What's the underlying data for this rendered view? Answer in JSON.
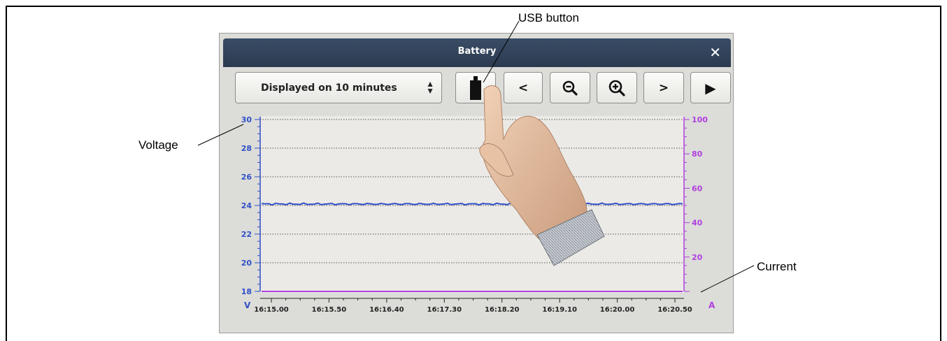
{
  "callouts": {
    "usb": "USB button",
    "voltage": "Voltage",
    "current": "Current"
  },
  "window": {
    "title": "Battery",
    "close_glyph": "✕"
  },
  "toolbar": {
    "range_select": {
      "value": "Displayed on 10 minutes",
      "icon": "up-down-arrows-icon"
    },
    "usb_button": {
      "icon": "usb-stick-icon"
    },
    "prev_button": {
      "glyph": "<",
      "icon": "chevron-left-icon"
    },
    "zoom_out_button": {
      "icon": "zoom-out-icon"
    },
    "zoom_in_button": {
      "icon": "zoom-in-icon"
    },
    "next_button": {
      "glyph": ">",
      "icon": "chevron-right-icon"
    },
    "play_button": {
      "glyph": "▶",
      "icon": "play-icon"
    }
  },
  "chart_data": {
    "type": "line",
    "x": [
      "16:15.00",
      "16:15.50",
      "16:16.40",
      "16:17.30",
      "16:18.20",
      "16:19.10",
      "16:20.00",
      "16:20.50"
    ],
    "y_left": {
      "unit": "V",
      "ylim": [
        18,
        30
      ],
      "ticks": [
        18,
        20,
        22,
        24,
        26,
        28,
        30
      ],
      "color": "#3050c8"
    },
    "y_right": {
      "unit": "A",
      "ylim": [
        0,
        100
      ],
      "ticks": [
        20,
        40,
        60,
        80,
        100
      ],
      "color": "#b040e0"
    },
    "grid": true,
    "series": [
      {
        "axis": "left",
        "color": "#3050c8",
        "values": [
          24.1,
          24.1,
          24.1,
          24.1,
          24.1,
          24.1,
          24.1,
          24.1
        ]
      },
      {
        "axis": "right",
        "color": "#b040e0",
        "values": [
          0,
          0,
          0,
          0,
          0,
          0,
          0,
          0
        ]
      }
    ]
  }
}
